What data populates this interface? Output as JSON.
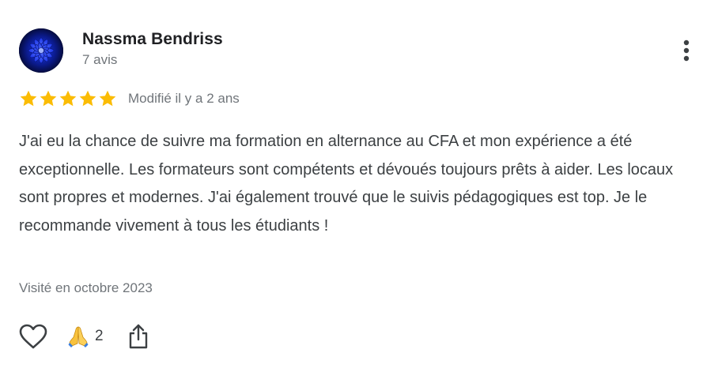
{
  "review": {
    "author": {
      "name": "Nassma Bendriss",
      "meta": "7 avis",
      "avatar_icon": "blue-flower-avatar"
    },
    "rating": {
      "value": 5,
      "max": 5,
      "star_color": "#fbbc04"
    },
    "edited_label": "Modifié il y a 2 ans",
    "text": "J'ai eu la chance de suivre ma formation en alternance au CFA et mon expérience a été exceptionnelle. Les formateurs sont compétents et dévoués toujours prêts à aider. Les locaux sont propres et modernes. J'ai également trouvé que le suivis pédagogiques est top. Je le recommande vivement à tous les étudiants !",
    "visit_label": "Visité en octobre 2023",
    "actions": {
      "like_icon": "heart-outline-icon",
      "reaction_icon": "folded-hands-emoji",
      "reaction_count": "2",
      "share_icon": "share-icon",
      "more_icon": "more-vert-icon"
    }
  }
}
